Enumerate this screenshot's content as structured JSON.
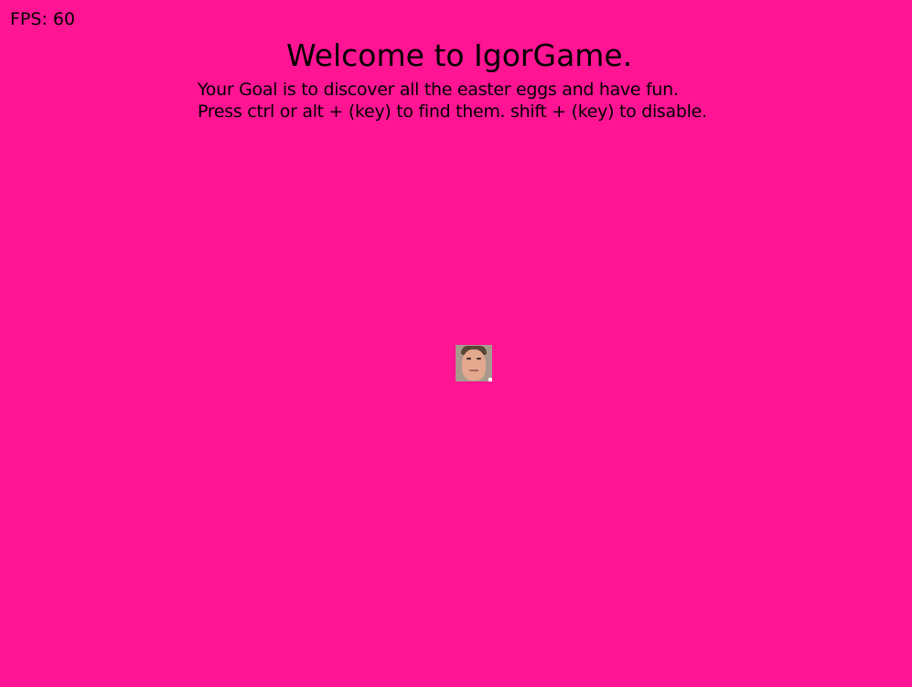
{
  "colors": {
    "background": "#ff1493",
    "text": "#000000"
  },
  "hud": {
    "fps_label": "FPS: 60"
  },
  "welcome": {
    "title": "Welcome to IgorGame.",
    "goal": "Your Goal is to discover all the easter eggs and have fun.",
    "instructions": "Press ctrl or alt + (key) to find them. shift + (key) to disable."
  },
  "player": {
    "icon": "player-face-sprite"
  }
}
